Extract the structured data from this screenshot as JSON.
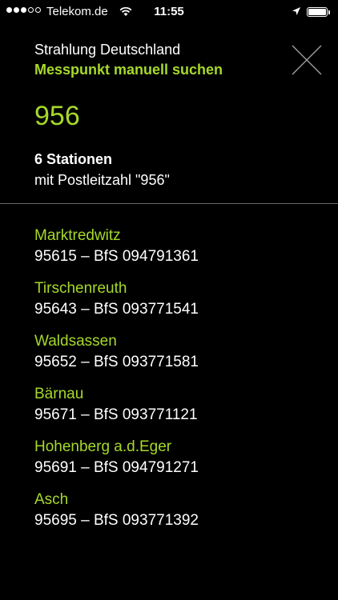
{
  "status_bar": {
    "carrier": "Telekom.de",
    "time": "11:55",
    "signal_bars_filled": 3,
    "signal_bars_total": 5
  },
  "header": {
    "title": "Strahlung Deutschland",
    "subtitle": "Messpunkt manuell suchen",
    "close_icon": "close-x-icon"
  },
  "search": {
    "value": "956"
  },
  "result": {
    "count_label": "6 Stationen",
    "postcode_label": "mit Postleitzahl \"956\""
  },
  "stations": [
    {
      "name": "Marktredwitz",
      "info": "95615 – BfS 094791361"
    },
    {
      "name": "Tirschenreuth",
      "info": "95643 – BfS 093771541"
    },
    {
      "name": "Waldsassen",
      "info": "95652 – BfS 093771581"
    },
    {
      "name": "Bärnau",
      "info": "95671 – BfS 093771121"
    },
    {
      "name": "Hohenberg a.d.Eger",
      "info": "95691 – BfS 094791271"
    },
    {
      "name": "Asch",
      "info": "95695 – BfS 093771392"
    }
  ],
  "colors": {
    "accent": "#a6d82a",
    "background": "#000000",
    "divider": "#6a6a6a"
  }
}
